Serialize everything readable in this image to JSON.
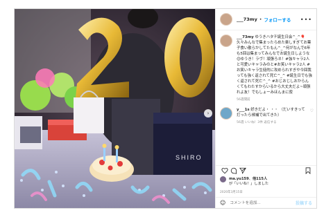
{
  "post": {
    "username": "___73my",
    "separator": "•",
    "follow_label": "フォローする",
    "more_label": "•••",
    "caption_author": "___73my",
    "caption_text": "ゆうきハタチ誕生日会^_^🎈 久々みんなで集まったらめた楽しすぎてお菓子食い散らかしてたもん^_^何がなんで6年も5回は集まってみんなでお誕生日しような😊ゆうき！ラヴ！頑張ろネ！#強キャラ2人と可愛いキャラみのと#お笑いキャラ2人 #お笑いキャラ生徒的に攻められすぎや今回我っても強く返されて死亡^_^ #誕生日でも強く返されて死亡^_^ #おじおじしおからんくてもわたすからいるから大丈夫だよ~頑張れよ友！でもしょーみほんまに寂",
    "caption_time": "56週間前",
    "comment_author": "y___1s",
    "comment_text": "好きだよ・ ・・ （だいすきって打ったら候補で出てきた）",
    "comment_time": "56週 いいね！3件 返信する",
    "likes_text": "ma.yu159、他115人 が「いいね！」しました",
    "likes_user": "ma.yu159",
    "likes_others": "他115人",
    "likes_suffix": "が「いいね！」しました",
    "date": "2020年3月15日",
    "comment_placeholder": "コメントを追加...",
    "post_button": "投稿する",
    "photo_box_label": "SHIRO"
  },
  "colors": {
    "accent": "#0095f6",
    "muted": "#8e8e8e",
    "text": "#262626",
    "balloon_gold": "#e8b936"
  },
  "icons": [
    "heart-icon",
    "comment-icon",
    "share-icon",
    "bookmark-icon",
    "emoji-icon",
    "next-icon",
    "more-icon"
  ]
}
